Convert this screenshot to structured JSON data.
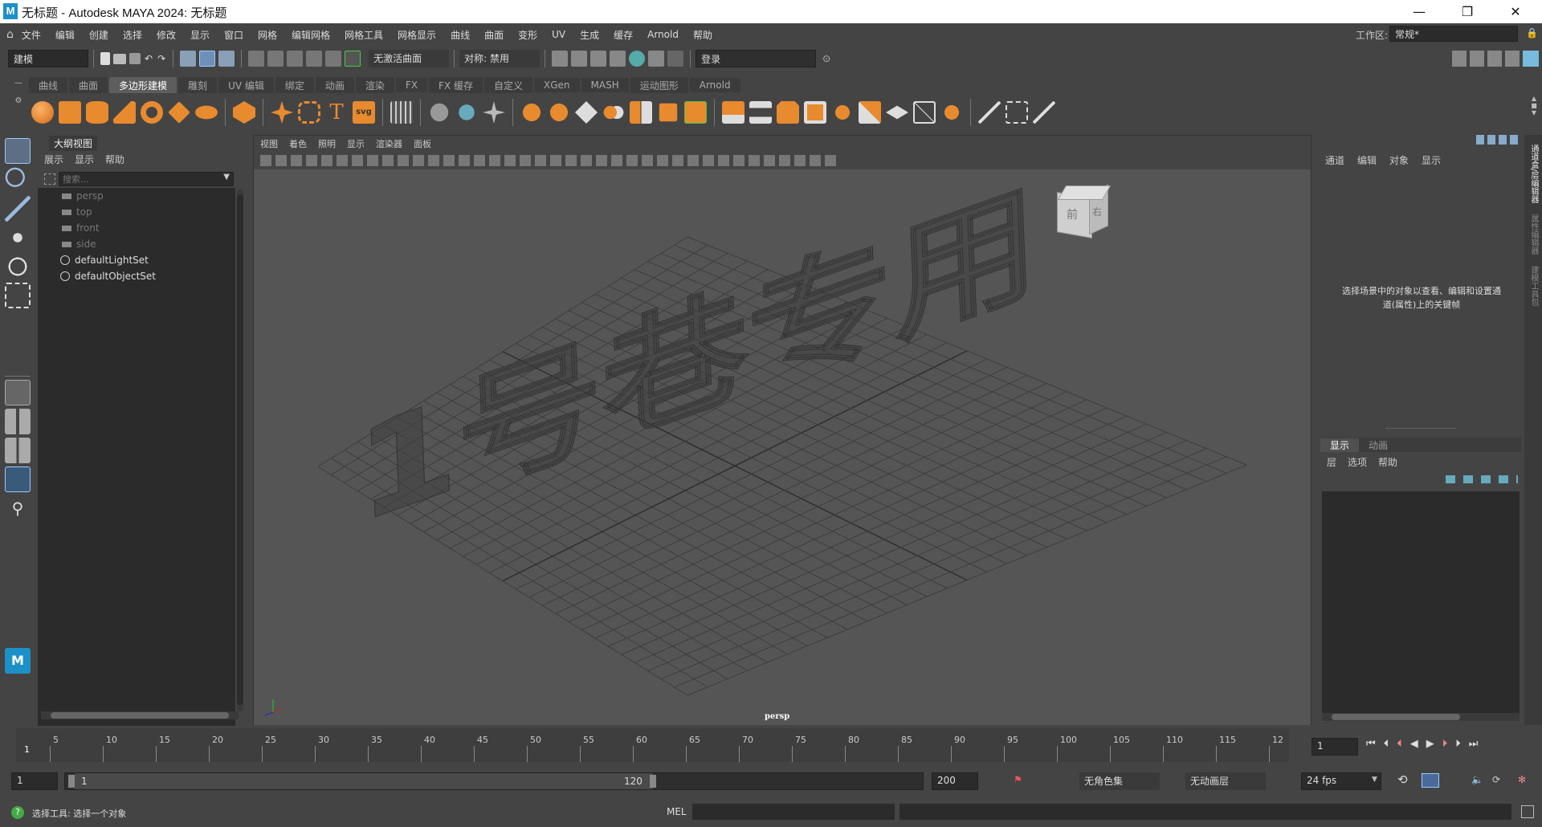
{
  "window": {
    "title": "无标题 - Autodesk MAYA 2024: 无标题",
    "controls": [
      "—",
      "❐",
      "✕"
    ]
  },
  "menu": [
    "文件",
    "编辑",
    "创建",
    "选择",
    "修改",
    "显示",
    "窗口",
    "网格",
    "编辑网格",
    "网格工具",
    "网格显示",
    "曲线",
    "曲面",
    "变形",
    "UV",
    "生成",
    "缓存",
    "Arnold",
    "帮助"
  ],
  "workspace": {
    "label": "工作区:",
    "value": "常规*"
  },
  "status": {
    "mode": "建模",
    "live_surface": "无激活曲面",
    "symmetry": "对称: 禁用",
    "login": "登录"
  },
  "shelf": {
    "tabs": [
      "曲线",
      "曲面",
      "多边形建模",
      "雕刻",
      "UV 编辑",
      "绑定",
      "动画",
      "渲染",
      "FX",
      "FX 缓存",
      "自定义",
      "XGen",
      "MASH",
      "运动图形",
      "Arnold"
    ],
    "active": "多边形建模"
  },
  "outliner": {
    "title": "大纲视图",
    "menu": [
      "展示",
      "显示",
      "帮助"
    ],
    "search_placeholder": "搜索...",
    "items": [
      {
        "label": "persp",
        "icon": "camera-icon"
      },
      {
        "label": "top",
        "icon": "camera-icon"
      },
      {
        "label": "front",
        "icon": "camera-icon"
      },
      {
        "label": "side",
        "icon": "camera-icon"
      },
      {
        "label": "defaultLightSet",
        "icon": "set-icon"
      },
      {
        "label": "defaultObjectSet",
        "icon": "set-icon"
      }
    ]
  },
  "viewport": {
    "menu": [
      "视图",
      "着色",
      "照明",
      "显示",
      "渲染器",
      "面板"
    ],
    "camera_label": "persp",
    "watermark": "1号巷专用",
    "viewcube_labels": [
      "前",
      "右"
    ]
  },
  "channelbox": {
    "menu": [
      "通道",
      "编辑",
      "对象",
      "显示"
    ],
    "hint": "选择场景中的对象以查看、编辑和设置通道(属性)上的关键帧",
    "layer_tabs": [
      "显示",
      "动画"
    ],
    "layer_menu": [
      "层",
      "选项",
      "帮助"
    ]
  },
  "right_strip": [
    "通道盒/层编辑器",
    "属性编辑器",
    "建模工具包"
  ],
  "timeline": {
    "ticks": [
      "5",
      "10",
      "15",
      "20",
      "25",
      "30",
      "35",
      "40",
      "45",
      "50",
      "55",
      "60",
      "65",
      "70",
      "75",
      "80",
      "85",
      "90",
      "95",
      "100",
      "105",
      "110",
      "115",
      "12"
    ],
    "start_marker": "1",
    "current_frame": "1"
  },
  "range": {
    "start": "1",
    "range_start": "1",
    "range_end": "120",
    "end": "200",
    "character_set": "无角色集",
    "anim_layer": "无动画层",
    "fps": "24 fps"
  },
  "command": {
    "help_text": "选择工具: 选择一个对象",
    "lang": "MEL"
  }
}
